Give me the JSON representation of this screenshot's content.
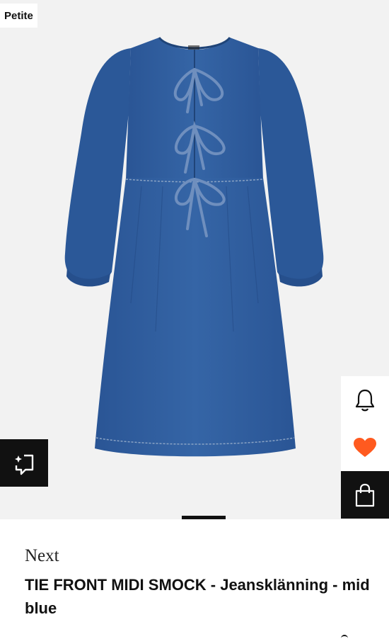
{
  "badge": {
    "label": "Petite"
  },
  "product": {
    "brand": "Next",
    "title": "TIE FRONT MIDI SMOCK - Jeansklänning - mid blue",
    "image_icon": "denim-dress-image",
    "label_tag": "NEXT"
  },
  "actions": {
    "ai_icon": "sparkle-frame-icon",
    "notify_icon": "bell-icon",
    "wishlist_icon": "heart-icon",
    "cart_icon": "shopping-bag-icon",
    "wishlist_color": "#ff5a1f"
  },
  "colors": {
    "denim": "#2f5b9a",
    "denim_dark": "#234b85",
    "accent": "#ff5a1f"
  }
}
